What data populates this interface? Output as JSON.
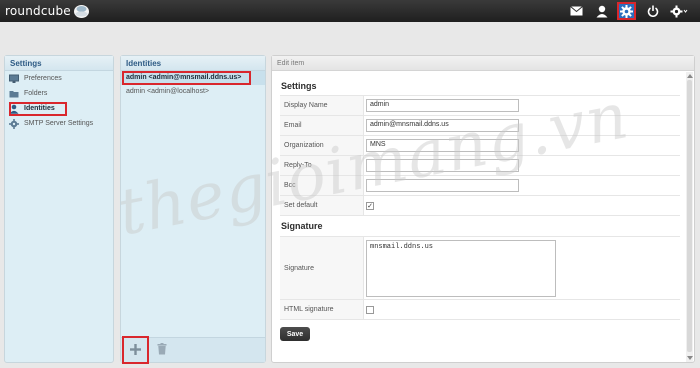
{
  "app": {
    "logo_text": "roundcube"
  },
  "topbar": {
    "icons": [
      "mail-icon",
      "contacts-icon",
      "settings-icon",
      "logout-icon",
      "about-icon"
    ],
    "active_color": "#2a6fbf",
    "highlight_color": "#d9272d"
  },
  "settings_panel": {
    "title": "Settings",
    "items": [
      {
        "label": "Preferences",
        "icon": "monitor-icon"
      },
      {
        "label": "Folders",
        "icon": "folder-icon"
      },
      {
        "label": "Identities",
        "icon": "person-icon",
        "selected": true
      },
      {
        "label": "SMTP Server Settings",
        "icon": "gear-icon"
      }
    ]
  },
  "identities_panel": {
    "title": "Identities",
    "items": [
      {
        "label": "admin <admin@mnsmail.ddns.us>",
        "selected": true
      },
      {
        "label": "admin <admin@localhost>"
      }
    ],
    "add_icon": "plus-icon",
    "delete_icon": "trash-icon"
  },
  "edit_panel": {
    "header": "Edit item",
    "settings_title": "Settings",
    "fields": {
      "display_name": {
        "label": "Display Name",
        "value": "admin"
      },
      "email": {
        "label": "Email",
        "value": "admin@mnsmail.ddns.us"
      },
      "organization": {
        "label": "Organization",
        "value": "MNS"
      },
      "reply_to": {
        "label": "Reply-To",
        "value": ""
      },
      "bcc": {
        "label": "Bcc",
        "value": ""
      },
      "set_default": {
        "label": "Set default",
        "checked": true
      }
    },
    "signature_title": "Signature",
    "signature": {
      "label": "Signature",
      "value": "mnsmail.ddns.us"
    },
    "html_signature": {
      "label": "HTML signature",
      "checked": false
    },
    "save_label": "Save"
  },
  "watermark": {
    "text": "thegioimang.vn"
  }
}
